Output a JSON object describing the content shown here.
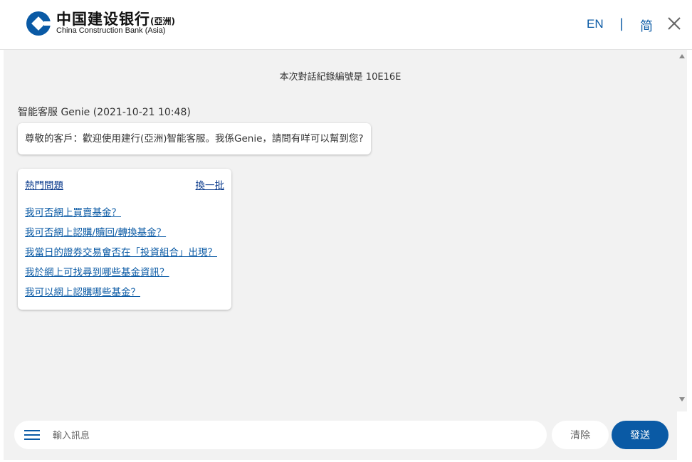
{
  "header": {
    "logo_cn": "中国建设银行",
    "logo_cn_sub": "(亞洲)",
    "logo_en": "China Construction Bank (Asia)",
    "lang_en": "EN",
    "lang_sep": "|",
    "lang_sc": "简",
    "close_icon": "close-icon",
    "brand_color": "#0a5aa5"
  },
  "chat": {
    "session_text": "本次對話紀錄編號是 10E16E",
    "bot_name": "智能客服 Genie (2021-10-21 10:48)",
    "greeting": "尊敬的客戶：歡迎使用建行(亞洲)智能客服。我係Genie，請問有咩可以幫到您?",
    "faq": {
      "title": "熱門問題",
      "refresh": "換一批",
      "items": [
        "我可否網上買賣基金？",
        "我可否網上認購/贖回/轉換基金？",
        "我當日的證券交易會否在「投資組合」出現？",
        "我於網上可找尋到哪些基金資訊？",
        "我可以網上認購哪些基金？"
      ]
    }
  },
  "input": {
    "menu_icon": "hamburger-menu-icon",
    "placeholder": "輸入訊息",
    "value": "",
    "clear_label": "清除",
    "send_label": "發送"
  }
}
